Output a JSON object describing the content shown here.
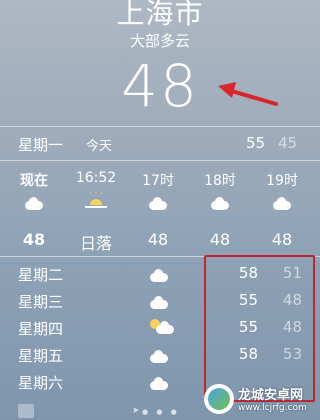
{
  "location": {
    "city": "上海市",
    "condition": "大部多云",
    "current_temp": "48"
  },
  "today": {
    "day": "星期一",
    "label": "今天",
    "high": "55",
    "low": "45"
  },
  "hourly": [
    {
      "time": "现在",
      "icon": "cloud-icon",
      "value": "48"
    },
    {
      "time": "16:52",
      "icon": "sunset-icon",
      "value": "日落"
    },
    {
      "time": "17时",
      "icon": "cloud-icon",
      "value": "48"
    },
    {
      "time": "18时",
      "icon": "cloud-icon",
      "value": "48"
    },
    {
      "time": "19时",
      "icon": "cloud-icon",
      "value": "48"
    }
  ],
  "daily": [
    {
      "day": "星期二",
      "icon": "cloud-icon",
      "high": "58",
      "low": "51"
    },
    {
      "day": "星期三",
      "icon": "cloud-icon",
      "high": "55",
      "low": "48"
    },
    {
      "day": "星期四",
      "icon": "partly-sunny-icon",
      "high": "55",
      "low": "48"
    },
    {
      "day": "星期五",
      "icon": "cloud-icon",
      "high": "58",
      "low": "53"
    },
    {
      "day": "星期六",
      "icon": "rain-icon",
      "high": "",
      "low": ""
    }
  ],
  "watermark": {
    "title": "龙城安卓网",
    "url": "www.lcjrfg.com"
  },
  "colors": {
    "highlight_box": "#c0252b",
    "arrow": "#d8262b",
    "sun": "#f7d35b"
  }
}
